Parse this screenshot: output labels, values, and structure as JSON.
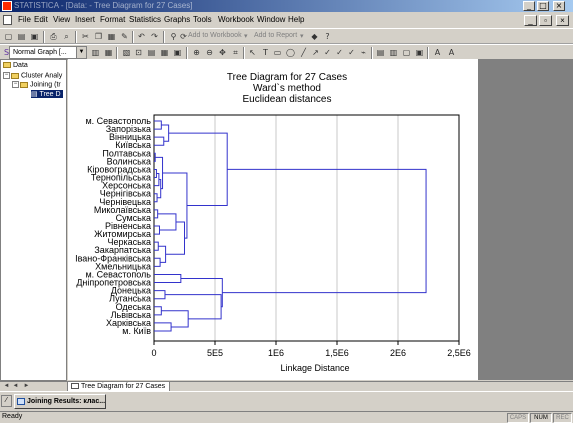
{
  "window": {
    "title": "STATISTICA - [Data: - Tree Diagram for 27 Cases]"
  },
  "menu": [
    "File",
    "Edit",
    "View",
    "Insert",
    "Format",
    "Statistics",
    "Graphs",
    "Tools",
    "Workbook",
    "Window",
    "Help"
  ],
  "toolbar": {
    "graph_type": "Normal Graph [...",
    "add_to_workbook": "Add to Workbook",
    "add_to_report": "Add to Report"
  },
  "tree": {
    "root": "Data",
    "items": [
      "Cluster Analy",
      "Joining (tr",
      "Tree D"
    ]
  },
  "chart_data": {
    "type": "dendrogram",
    "title": "Tree Diagram for 27 Cases",
    "subtitle_lines": [
      "Ward`s method",
      "Euclidean distances"
    ],
    "xlabel": "Linkage Distance",
    "xlim": [
      0,
      2500000
    ],
    "xticks": [
      0,
      500000,
      1000000,
      1500000,
      2000000,
      2500000
    ],
    "xtick_labels": [
      "0",
      "5E5",
      "1E6",
      "1,5E6",
      "2E6",
      "2,5E6"
    ],
    "grid": true,
    "case_labels": [
      "м. Севастополь",
      "Запорізька",
      "Вінницька",
      "Київська",
      "Полтавська",
      "Волинська",
      "Кіровоградська",
      "Тернопільська",
      "Херсонська",
      "Чернігівська",
      "Чернівецька",
      "Миколаївська",
      "Сумська",
      "Рівненська",
      "Житомирська",
      "Черкаська",
      "Закарпатська",
      "Івано-Франківська",
      "Хмельницька",
      "м. Севастополь",
      "Дніпропетровська",
      "Донецька",
      "Луганська",
      "Одеська",
      "Львівська",
      "Харківська",
      "м. Київ"
    ],
    "merges": [
      [
        0,
        1,
        60000
      ],
      [
        2,
        3,
        80000
      ],
      [
        27,
        28,
        120000
      ],
      [
        4,
        5,
        10000
      ],
      [
        6,
        7,
        20000
      ],
      [
        31,
        8,
        40000
      ],
      [
        9,
        10,
        25000
      ],
      [
        32,
        33,
        55000
      ],
      [
        30,
        34,
        70000
      ],
      [
        11,
        12,
        30000
      ],
      [
        13,
        14,
        45000
      ],
      [
        36,
        37,
        180000
      ],
      [
        15,
        16,
        35000
      ],
      [
        17,
        18,
        50000
      ],
      [
        39,
        40,
        95000
      ],
      [
        38,
        41,
        250000
      ],
      [
        35,
        42,
        270000
      ],
      [
        29,
        43,
        600000
      ],
      [
        19,
        20,
        220000
      ],
      [
        21,
        22,
        90000
      ],
      [
        23,
        24,
        60000
      ],
      [
        25,
        26,
        140000
      ],
      [
        47,
        48,
        280000
      ],
      [
        46,
        49,
        550000
      ],
      [
        45,
        50,
        560000
      ],
      [
        44,
        51,
        2230000
      ]
    ]
  },
  "tabs": [
    "Tree Diagram for 27 Cases"
  ],
  "taskbar": {
    "item": "Joining Results: клас..."
  },
  "status": {
    "text": "Ready",
    "indicators": [
      "CAPS",
      "NUM",
      "REC"
    ],
    "active": [
      "NUM"
    ]
  }
}
